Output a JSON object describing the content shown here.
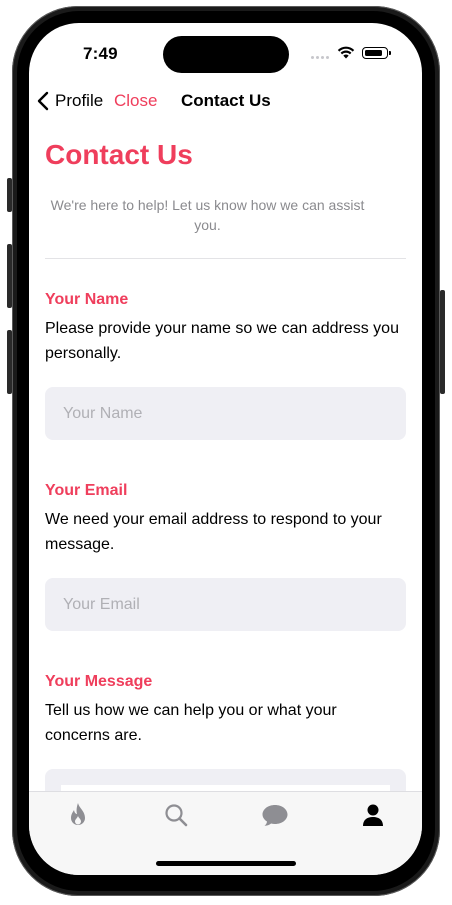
{
  "status_bar": {
    "time": "7:49"
  },
  "nav": {
    "back_label": "Profile",
    "close_label": "Close",
    "title": "Contact Us"
  },
  "page": {
    "title": "Contact Us",
    "intro": "We're here to help! Let us know how we can assist you."
  },
  "form": {
    "name": {
      "label": "Your Name",
      "description": "Please provide your name so we can address you personally.",
      "placeholder": "Your Name",
      "value": ""
    },
    "email": {
      "label": "Your Email",
      "description": "We need your email address to respond to your message.",
      "placeholder": "Your Email",
      "value": ""
    },
    "message": {
      "label": "Your Message",
      "description": "Tell us how we can help you or what your concerns are."
    }
  },
  "tabbar": {
    "tabs": [
      {
        "icon": "flame-icon",
        "selected": false
      },
      {
        "icon": "search-icon",
        "selected": false
      },
      {
        "icon": "chat-bubble-icon",
        "selected": false
      },
      {
        "icon": "person-icon",
        "selected": true
      }
    ]
  },
  "colors": {
    "accent": "#ef3e5c",
    "field_bg": "#efeff4",
    "tab_inactive": "#8e8e93",
    "tab_active": "#000000"
  }
}
